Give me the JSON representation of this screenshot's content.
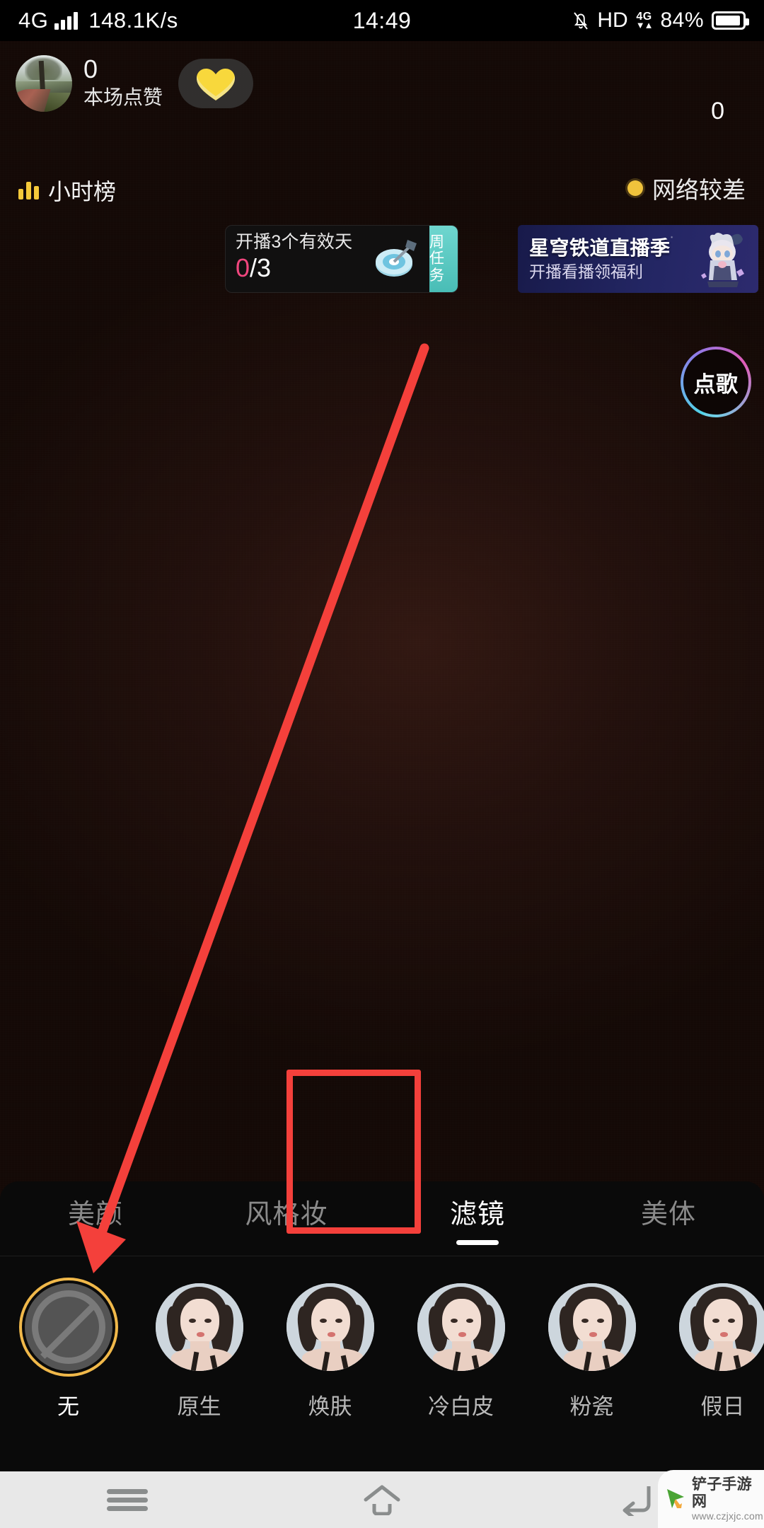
{
  "status_bar": {
    "network_type": "4G",
    "speed": "148.1K/s",
    "time": "14:49",
    "hd_label": "HD",
    "data_label": "4G",
    "battery_percent": "84%",
    "icons": [
      "signal-bars-icon",
      "mute-bell-icon",
      "hd-icon",
      "data-arrows-icon",
      "battery-icon"
    ]
  },
  "live_header": {
    "host": {
      "like_count": "0",
      "like_label": "本场点赞",
      "avatar_icon": "avatar"
    },
    "heart_button_icon": "heart-icon",
    "viewer_count": "0",
    "hour_rank_label": "小时榜",
    "hour_rank_icon": "bar-chart-icon",
    "network_status_label": "网络较差",
    "network_status_icon": "status-dot-icon",
    "network_status_color": "#f0c33c"
  },
  "task_banner": {
    "title": "开播3个有效天",
    "progress_current": "0",
    "progress_separator": "/",
    "progress_total": "3",
    "progress_color": "#f0467e",
    "icon": "dart-target-icon",
    "tab_label": "周任务",
    "tab_color": "#56c7c0"
  },
  "promo_banner": {
    "title": "星穹铁道直播季",
    "subtitle": "开播看播领福利",
    "character_icon": "anime-character-icon",
    "background_color": "#232663"
  },
  "song_button": {
    "label": "点歌",
    "ring_colors": [
      "#4fd6e8",
      "#e05bb8"
    ]
  },
  "beauty_panel": {
    "tabs": [
      {
        "label": "美颜",
        "active": false
      },
      {
        "label": "风格妆",
        "active": false
      },
      {
        "label": "滤镜",
        "active": true
      },
      {
        "label": "美体",
        "active": false
      }
    ],
    "filters": [
      {
        "label": "无",
        "selected": true,
        "thumb": "no-filter-icon"
      },
      {
        "label": "原生",
        "selected": false,
        "thumb": "portrait-thumb"
      },
      {
        "label": "焕肤",
        "selected": false,
        "thumb": "portrait-thumb"
      },
      {
        "label": "冷白皮",
        "selected": false,
        "thumb": "portrait-thumb"
      },
      {
        "label": "粉瓷",
        "selected": false,
        "thumb": "portrait-thumb"
      },
      {
        "label": "假日",
        "selected": false,
        "thumb": "portrait-thumb"
      }
    ],
    "selected_ring_color": "#f0b84a"
  },
  "nav_bar": {
    "buttons": [
      {
        "name": "recent-apps",
        "icon": "menu-icon"
      },
      {
        "name": "home",
        "icon": "home-icon"
      },
      {
        "name": "back",
        "icon": "back-arrow-icon"
      }
    ]
  },
  "watermark": {
    "site_name": "铲子手游网",
    "site_url": "www.czjxjc.com",
    "icon": "cursor-play-icon"
  },
  "annotations": {
    "highlight_color": "#f4403b",
    "arrow_icon": "pointer-arrow-annotation",
    "highlight_target": "滤镜",
    "arrow_target": "无"
  }
}
